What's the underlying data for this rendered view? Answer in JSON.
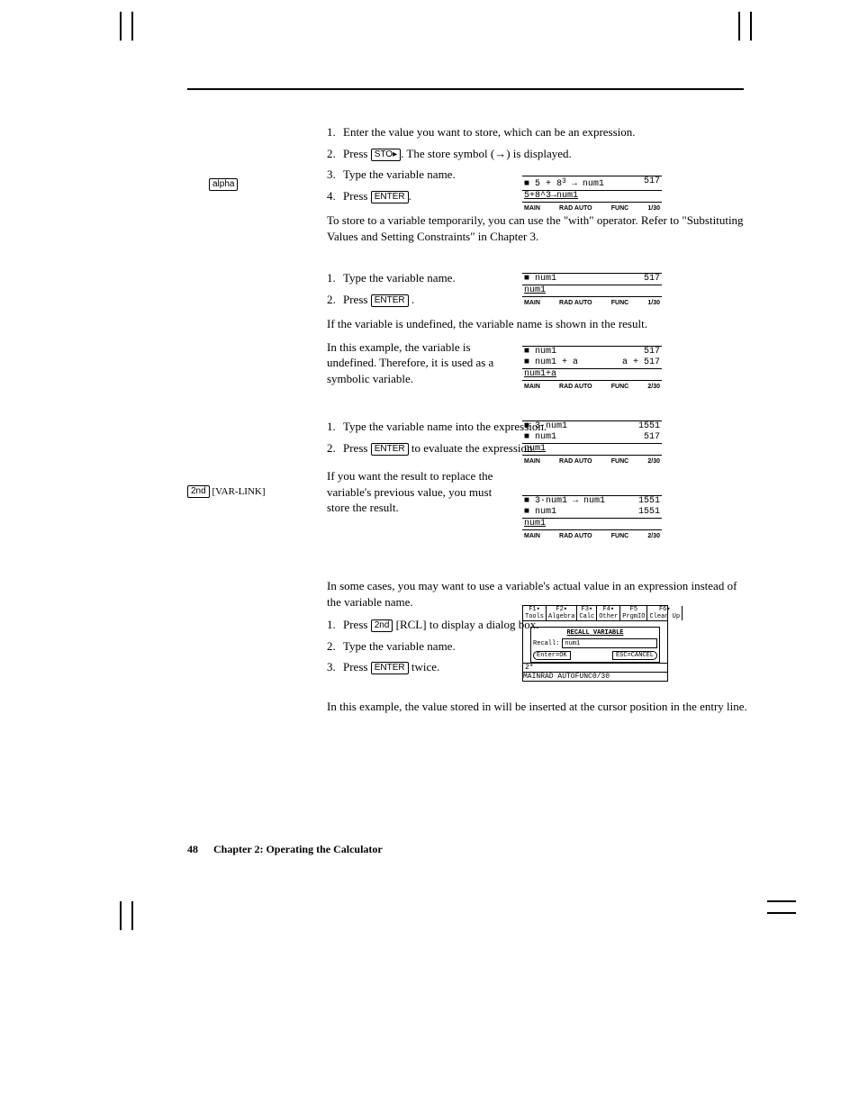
{
  "keys": {
    "sto": "STO▸",
    "enter": "ENTER",
    "second": "2nd",
    "varlink": "[VAR-LINK]",
    "rcl": "[RCL]",
    "alpha": "alpha"
  },
  "section1": {
    "li1": "Enter the value you want to store, which can be an expression.",
    "li2a": "Press ",
    "li2b": ". The store symbol (→) is displayed.",
    "li3": "Type the variable name.",
    "li4a": "Press ",
    "li4b": ".",
    "after": "To store to a variable temporarily, you can use the \"with\" operator. Refer to \"Substituting Values and Setting Constraints\" in Chapter 3."
  },
  "calc1": {
    "l1a": "■ 5 + 8",
    "l1exp": "3",
    "l1b": " → num1",
    "r1": "517",
    "entry": "5+8^3→num1",
    "status": {
      "a": "MAIN",
      "b": "RAD AUTO",
      "c": "FUNC",
      "d": "1/30"
    }
  },
  "section2": {
    "li1": "Type the variable name.",
    "li2a": "Press ",
    "li2b": " .",
    "after": "If the variable is undefined, the variable name is shown in the result.",
    "para2": "In this example, the variable    is undefined. Therefore, it is used as a symbolic variable."
  },
  "calc2": {
    "l1": "■ num1",
    "r1": "517",
    "entry": "num1",
    "status": {
      "a": "MAIN",
      "b": "RAD AUTO",
      "c": "FUNC",
      "d": "1/30"
    }
  },
  "calc3": {
    "l1": "■ num1",
    "r1": "517",
    "l2": "■ num1 + a",
    "r2": "a + 517",
    "entry": "num1+a",
    "status": {
      "a": "MAIN",
      "b": "RAD AUTO",
      "c": "FUNC",
      "d": "2/30"
    }
  },
  "section3": {
    "li1": "Type the variable name into the expression.",
    "li2a": "Press ",
    "li2b": " to evaluate the expression.",
    "after": "If you want the result to replace the variable's previous value, you must store the result."
  },
  "calc4": {
    "l1": "■ 3·num1",
    "r1": "1551",
    "l2": "■ num1",
    "r2": "517",
    "entry": "num1",
    "status": {
      "a": "MAIN",
      "b": "RAD AUTO",
      "c": "FUNC",
      "d": "2/30"
    }
  },
  "calc5": {
    "l1": "■ 3·num1 → num1",
    "r1": "1551",
    "l2": "■ num1",
    "r2": "1551",
    "entry": "num1",
    "status": {
      "a": "MAIN",
      "b": "RAD AUTO",
      "c": "FUNC",
      "d": "2/30"
    }
  },
  "section4": {
    "intro": "In some cases, you may want to use a variable's actual value in an expression instead of the variable name.",
    "li1a": "Press ",
    "li1b": " to display a dialog box.",
    "li2": "Type the variable name.",
    "li3a": "Press ",
    "li3b": " twice.",
    "after": "In this example, the value stored in                                will be inserted at the cursor position in the entry line."
  },
  "dlg": {
    "menu": [
      "F1▾\nTools",
      "F2▾\nAlgebra",
      "F3▾\nCalc",
      "F4▾\nOther",
      "F5\nPrgmIO",
      "F6▾\nClean Up"
    ],
    "title": "RECALL VARIABLE",
    "label": "Recall:",
    "value": "num1",
    "ok": "Enter=OK",
    "cancel": "ESC=CANCEL",
    "entry": "2*",
    "status": {
      "a": "MAIN",
      "b": "RAD AUTO",
      "c": "FUNC",
      "d": "0/30"
    }
  },
  "footer": {
    "page": "48",
    "chapter": "Chapter 2: Operating the Calculator"
  }
}
